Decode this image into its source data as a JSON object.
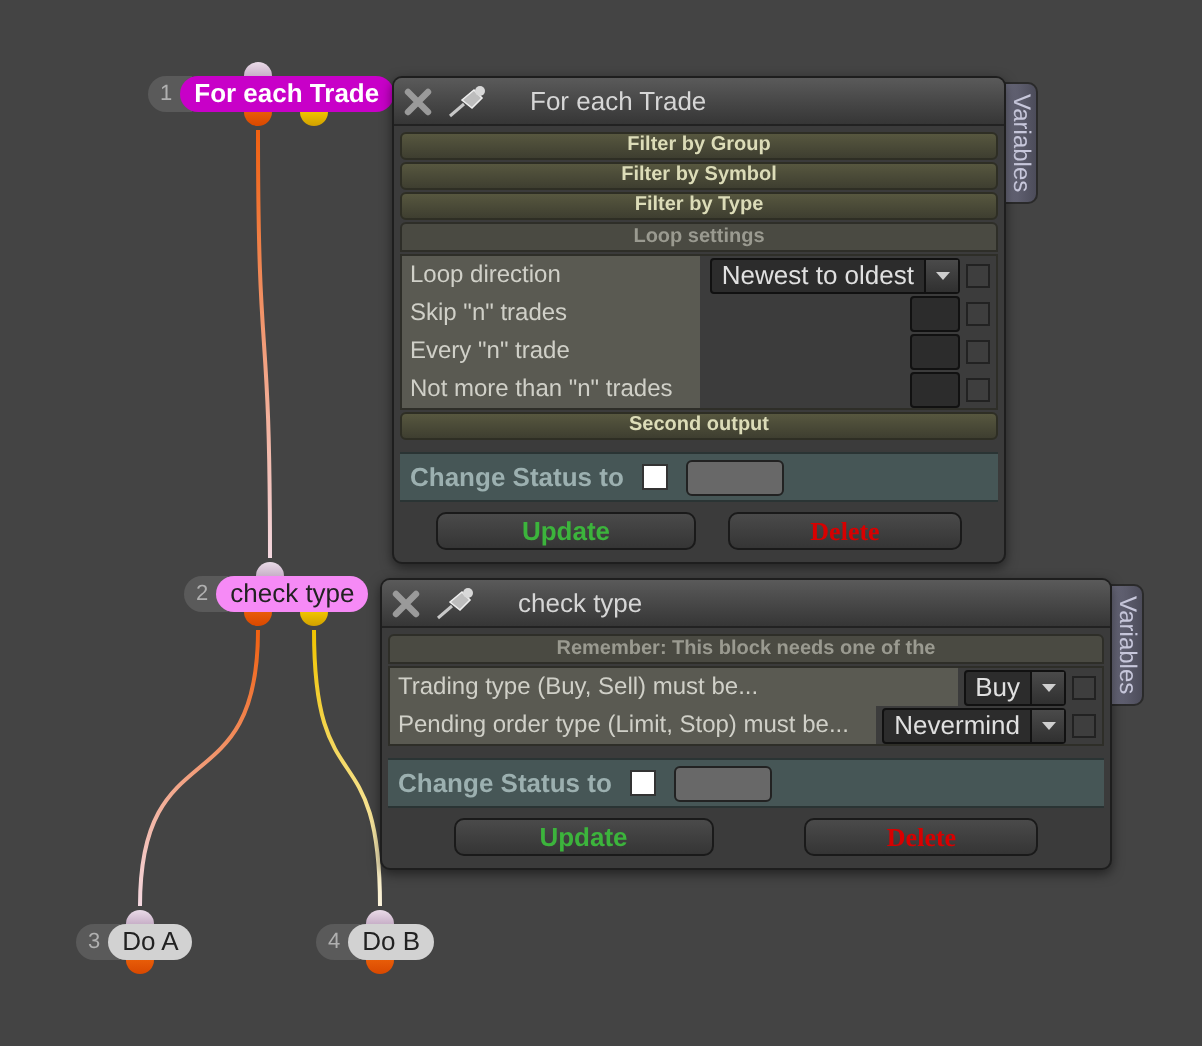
{
  "nodes": [
    {
      "number": "1",
      "label": "For each Trade",
      "color": "#c800c8",
      "second_output": true
    },
    {
      "number": "2",
      "label": "check type",
      "color": "#f68af6",
      "second_output": true
    },
    {
      "number": "3",
      "label": "Do A",
      "color": "#d2d2d2",
      "second_output": false
    },
    {
      "number": "4",
      "label": "Do B",
      "color": "#d2d2d2",
      "second_output": false
    }
  ],
  "panels": [
    {
      "title": "For each Trade",
      "side_tab": "Variables",
      "sections": [
        {
          "kind": "header",
          "label": "Filter by Group"
        },
        {
          "kind": "header",
          "label": "Filter by Symbol"
        },
        {
          "kind": "header",
          "label": "Filter by Type"
        },
        {
          "kind": "subheader",
          "label": "Loop settings"
        },
        {
          "kind": "fields",
          "rows": [
            {
              "kind": "select",
              "label": "Loop direction",
              "value": "Newest to oldest",
              "checked": false
            },
            {
              "kind": "number",
              "label": "Skip \"n\" trades",
              "checked": false
            },
            {
              "kind": "number",
              "label": "Every \"n\" trade",
              "checked": false
            },
            {
              "kind": "number",
              "label": "Not more than \"n\" trades",
              "checked": false
            }
          ]
        },
        {
          "kind": "header",
          "label": "Second output"
        }
      ],
      "status": {
        "label": "Change Status to",
        "checked": false
      },
      "buttons": [
        {
          "label": "Update",
          "kind": "update"
        },
        {
          "label": "Delete",
          "kind": "delete"
        }
      ]
    },
    {
      "title": "check type",
      "side_tab": "Variables",
      "sections": [
        {
          "kind": "subheader",
          "label": "Remember: This block needs one of the"
        },
        {
          "kind": "fields",
          "rows": [
            {
              "kind": "select",
              "label": "Trading type (Buy, Sell) must be...",
              "value": "Buy",
              "checked": false
            },
            {
              "kind": "select",
              "label": "Pending order type (Limit, Stop) must be...",
              "value": "Nevermind",
              "checked": false
            }
          ]
        }
      ],
      "status": {
        "label": "Change Status to",
        "checked": false
      },
      "buttons": [
        {
          "label": "Update",
          "kind": "update"
        },
        {
          "label": "Delete",
          "kind": "delete"
        }
      ]
    }
  ]
}
